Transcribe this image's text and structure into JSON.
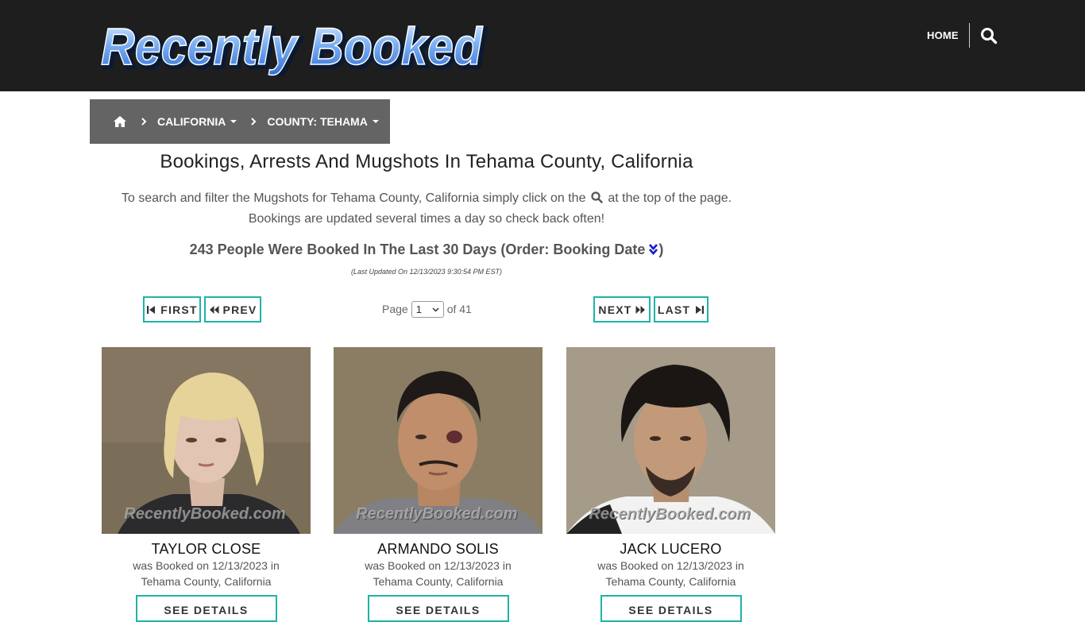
{
  "site": {
    "logo_text": "Recently Booked",
    "nav_home": "HOME"
  },
  "breadcrumb": {
    "state": "CALIFORNIA",
    "county": "COUNTY: TEHAMA"
  },
  "main": {
    "title": "Bookings, Arrests And Mugshots In Tehama County, California",
    "desc_line1_before": "To search and filter the Mugshots for Tehama County, California simply click on the",
    "desc_line1_after": "at the top of the page.",
    "desc_line2": "Bookings are updated several times a day so check back often!",
    "count_text": "243 People Were Booked In The Last 30 Days (Order: Booking Date",
    "count_close": ")",
    "last_updated": "(Last Updated On 12/13/2023 9:30:54 PM EST)"
  },
  "pager": {
    "first": "FIRST",
    "prev": "PREV",
    "next": "NEXT",
    "last": "LAST",
    "page_label": "Page",
    "page_value": "1",
    "of_label": "of 41"
  },
  "watermark": "RecentlyBooked.com",
  "people": [
    {
      "name": "TAYLOR CLOSE",
      "line1": "was Booked on 12/13/2023 in",
      "line2": "Tehama County, California",
      "button": "SEE DETAILS"
    },
    {
      "name": "ARMANDO SOLIS",
      "line1": "was Booked on 12/13/2023 in",
      "line2": "Tehama County, California",
      "button": "SEE DETAILS"
    },
    {
      "name": "JACK LUCERO",
      "line1": "was Booked on 12/13/2023 in",
      "line2": "Tehama County, California",
      "button": "SEE DETAILS"
    }
  ],
  "colors": {
    "header_bg": "#1e1e1e",
    "breadcrumb_bg": "#646464",
    "accent_teal": "#1fb3a8",
    "logo_blue": "#4a8fe6",
    "sort_icon": "#1a1ad0"
  },
  "icons": [
    "search-icon",
    "home-icon",
    "chevron-right-icon",
    "caret-down-icon",
    "double-chevron-down-icon",
    "first-icon",
    "prev-icon",
    "next-icon",
    "last-icon"
  ]
}
